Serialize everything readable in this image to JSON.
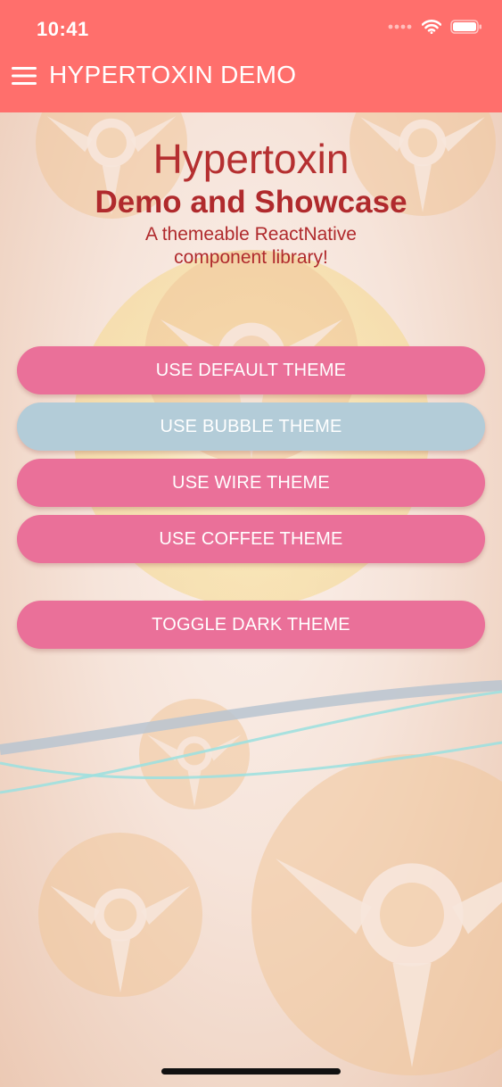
{
  "status_bar": {
    "time": "10:41",
    "icons": [
      "signal-dots-icon",
      "wifi-icon",
      "battery-icon"
    ]
  },
  "header": {
    "menu_icon": "hamburger-menu-icon",
    "title": "HYPERTOXIN DEMO",
    "background_color": "#ff6f6c"
  },
  "hero": {
    "title": "Hypertoxin",
    "subtitle": "Demo and Showcase",
    "tagline_line1": "A themeable ReactNative",
    "tagline_line2": "component library!",
    "text_color": "#b02a2d"
  },
  "buttons": [
    {
      "label": "USE DEFAULT THEME",
      "color": "#ea7099"
    },
    {
      "label": "USE BUBBLE THEME",
      "color": "#b3ccd8"
    },
    {
      "label": "USE WIRE THEME",
      "color": "#ea7099"
    },
    {
      "label": "USE COFFEE THEME",
      "color": "#ea7099"
    },
    {
      "label": "TOGGLE DARK THEME",
      "color": "#ea7099"
    }
  ]
}
